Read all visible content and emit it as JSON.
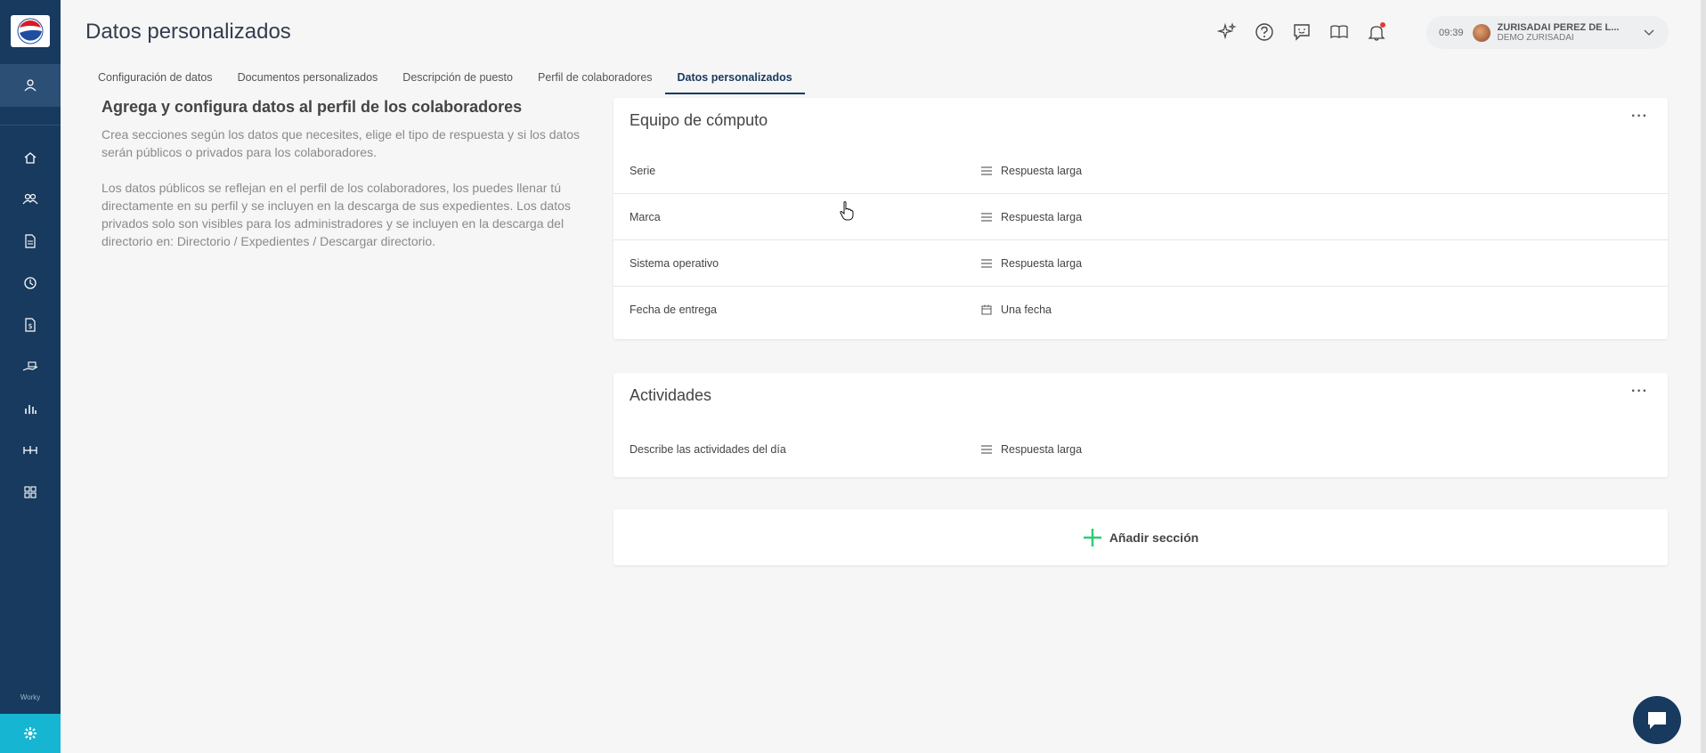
{
  "sidebar": {
    "brand": "Worky",
    "items": [
      {
        "icon": "user-icon"
      },
      {
        "icon": "home-icon"
      },
      {
        "icon": "people-icon"
      },
      {
        "icon": "document-icon"
      },
      {
        "icon": "clock-icon"
      },
      {
        "icon": "dollar-document-icon"
      },
      {
        "icon": "hand-money-icon"
      },
      {
        "icon": "bar-chart-icon"
      },
      {
        "icon": "organization-icon"
      },
      {
        "icon": "grid-icon"
      },
      {
        "icon": "gear-icon"
      }
    ]
  },
  "header": {
    "title": "Datos personalizados",
    "icons": [
      "sparkle-icon",
      "help-icon",
      "chat-icon",
      "book-icon",
      "bell-icon"
    ]
  },
  "user": {
    "time": "09:39",
    "name": "ZURISADAI PEREZ DE L...",
    "company": "DEMO ZURISADAI"
  },
  "tabs": [
    {
      "label": "Configuración de datos",
      "active": false
    },
    {
      "label": "Documentos personalizados",
      "active": false
    },
    {
      "label": "Descripción de puesto",
      "active": false
    },
    {
      "label": "Perfil de colaboradores",
      "active": false
    },
    {
      "label": "Datos personalizados",
      "active": true
    }
  ],
  "intro": {
    "heading": "Agrega y configura datos al perfil de los colaboradores",
    "paragraph1": "Crea secciones según los datos que necesites, elige el tipo de respuesta y si los datos serán públicos o privados para los colaboradores.",
    "paragraph2": "Los datos públicos se reflejan en el perfil de los colaboradores, los puedes llenar tú directamente en su perfil y se incluyen en la descarga de sus expedientes. Los datos privados solo son visibles para los administradores y se incluyen en la descarga del directorio en: Directorio / Expedientes / Descargar directorio."
  },
  "sections": [
    {
      "title": "Equipo de cómputo",
      "menu": "···",
      "fields": [
        {
          "label": "Serie",
          "type": "Respuesta larga",
          "icon": "lines-icon"
        },
        {
          "label": "Marca",
          "type": "Respuesta larga",
          "icon": "lines-icon"
        },
        {
          "label": "Sistema operativo",
          "type": "Respuesta larga",
          "icon": "lines-icon"
        },
        {
          "label": "Fecha de entrega",
          "type": "Una fecha",
          "icon": "calendar-icon"
        }
      ]
    },
    {
      "title": "Actividades",
      "menu": "···",
      "fields": [
        {
          "label": "Describe las actividades del día",
          "type": "Respuesta larga",
          "icon": "lines-icon"
        }
      ]
    }
  ],
  "add_section": {
    "label": "Añadir sección",
    "color": "#2ecc71"
  },
  "colors": {
    "sidebar": "#173a5e",
    "accent": "#16b6d3",
    "notification": "#e53935"
  }
}
